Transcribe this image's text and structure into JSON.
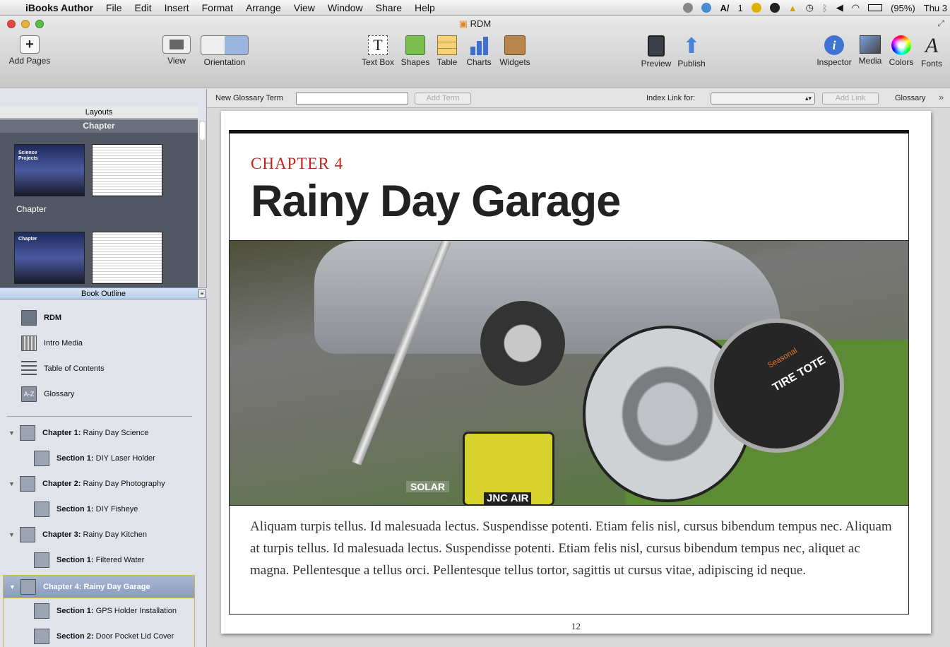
{
  "menubar": {
    "app": "iBooks Author",
    "items": [
      "File",
      "Edit",
      "Insert",
      "Format",
      "Arrange",
      "View",
      "Window",
      "Share",
      "Help"
    ],
    "right_text_1": "1",
    "battery": "(95%)",
    "clock": "Thu 3"
  },
  "window": {
    "title": "RDM"
  },
  "toolbar": {
    "add_pages": "Add Pages",
    "view": "View",
    "orientation": "Orientation",
    "text_box": "Text Box",
    "shapes": "Shapes",
    "table": "Table",
    "charts": "Charts",
    "widgets": "Widgets",
    "preview": "Preview",
    "publish": "Publish",
    "inspector": "Inspector",
    "media": "Media",
    "colors": "Colors",
    "fonts": "Fonts"
  },
  "glossary_bar": {
    "new_term_label": "New Glossary Term",
    "add_term": "Add Term",
    "index_link_label": "Index Link for:",
    "add_link": "Add Link",
    "glossary": "Glossary"
  },
  "sidebar": {
    "layouts_header": "Layouts",
    "chapter_header": "Chapter",
    "layout_label": "Chapter",
    "thumb1_text": "Science Projects",
    "thumb2_text": "Chapter",
    "outline_header": "Book Outline",
    "top_items": [
      "RDM",
      "Intro Media",
      "Table of Contents",
      "Glossary"
    ],
    "chapters": [
      {
        "kind": "Chapter 1:",
        "title": "Rainy Day Science"
      },
      {
        "kind": "Section 1:",
        "title": "DIY Laser Holder"
      },
      {
        "kind": "Chapter 2:",
        "title": "Rainy Day Photography"
      },
      {
        "kind": "Section 1:",
        "title": "DIY Fisheye"
      },
      {
        "kind": "Chapter 3:",
        "title": "Rainy Day Kitchen"
      },
      {
        "kind": "Section 1:",
        "title": "Filtered Water"
      },
      {
        "kind": "Chapter 4:",
        "title": "Rainy Day Garage"
      },
      {
        "kind": "Section 1:",
        "title": "GPS Holder Installation"
      },
      {
        "kind": "Section 2:",
        "title": "Door Pocket Lid Cover"
      }
    ]
  },
  "page": {
    "chapter_label": "CHAPTER 4",
    "title": "Rainy Day Garage",
    "body": "Aliquam turpis tellus. Id malesuada lectus. Suspendisse potenti. Etiam felis nisl, cursus bibendum tempus nec. Aliquam at turpis tellus. Id malesuada lectus. Suspendisse potenti. Etiam felis nisl, cursus bibendum tempus nec, aliquet ac magna. Pellentesque a tellus orci. Pellentesque tellus tortor, sagittis ut cursus vitae, adipiscing id neque.",
    "page_number": "12",
    "photo_texts": [
      "Seasonal",
      "TIRE TOTE",
      "SOLAR",
      "JNC AIR"
    ]
  },
  "colors": {
    "chapter_red": "#c0231e",
    "selection": "#8a9cbd"
  }
}
